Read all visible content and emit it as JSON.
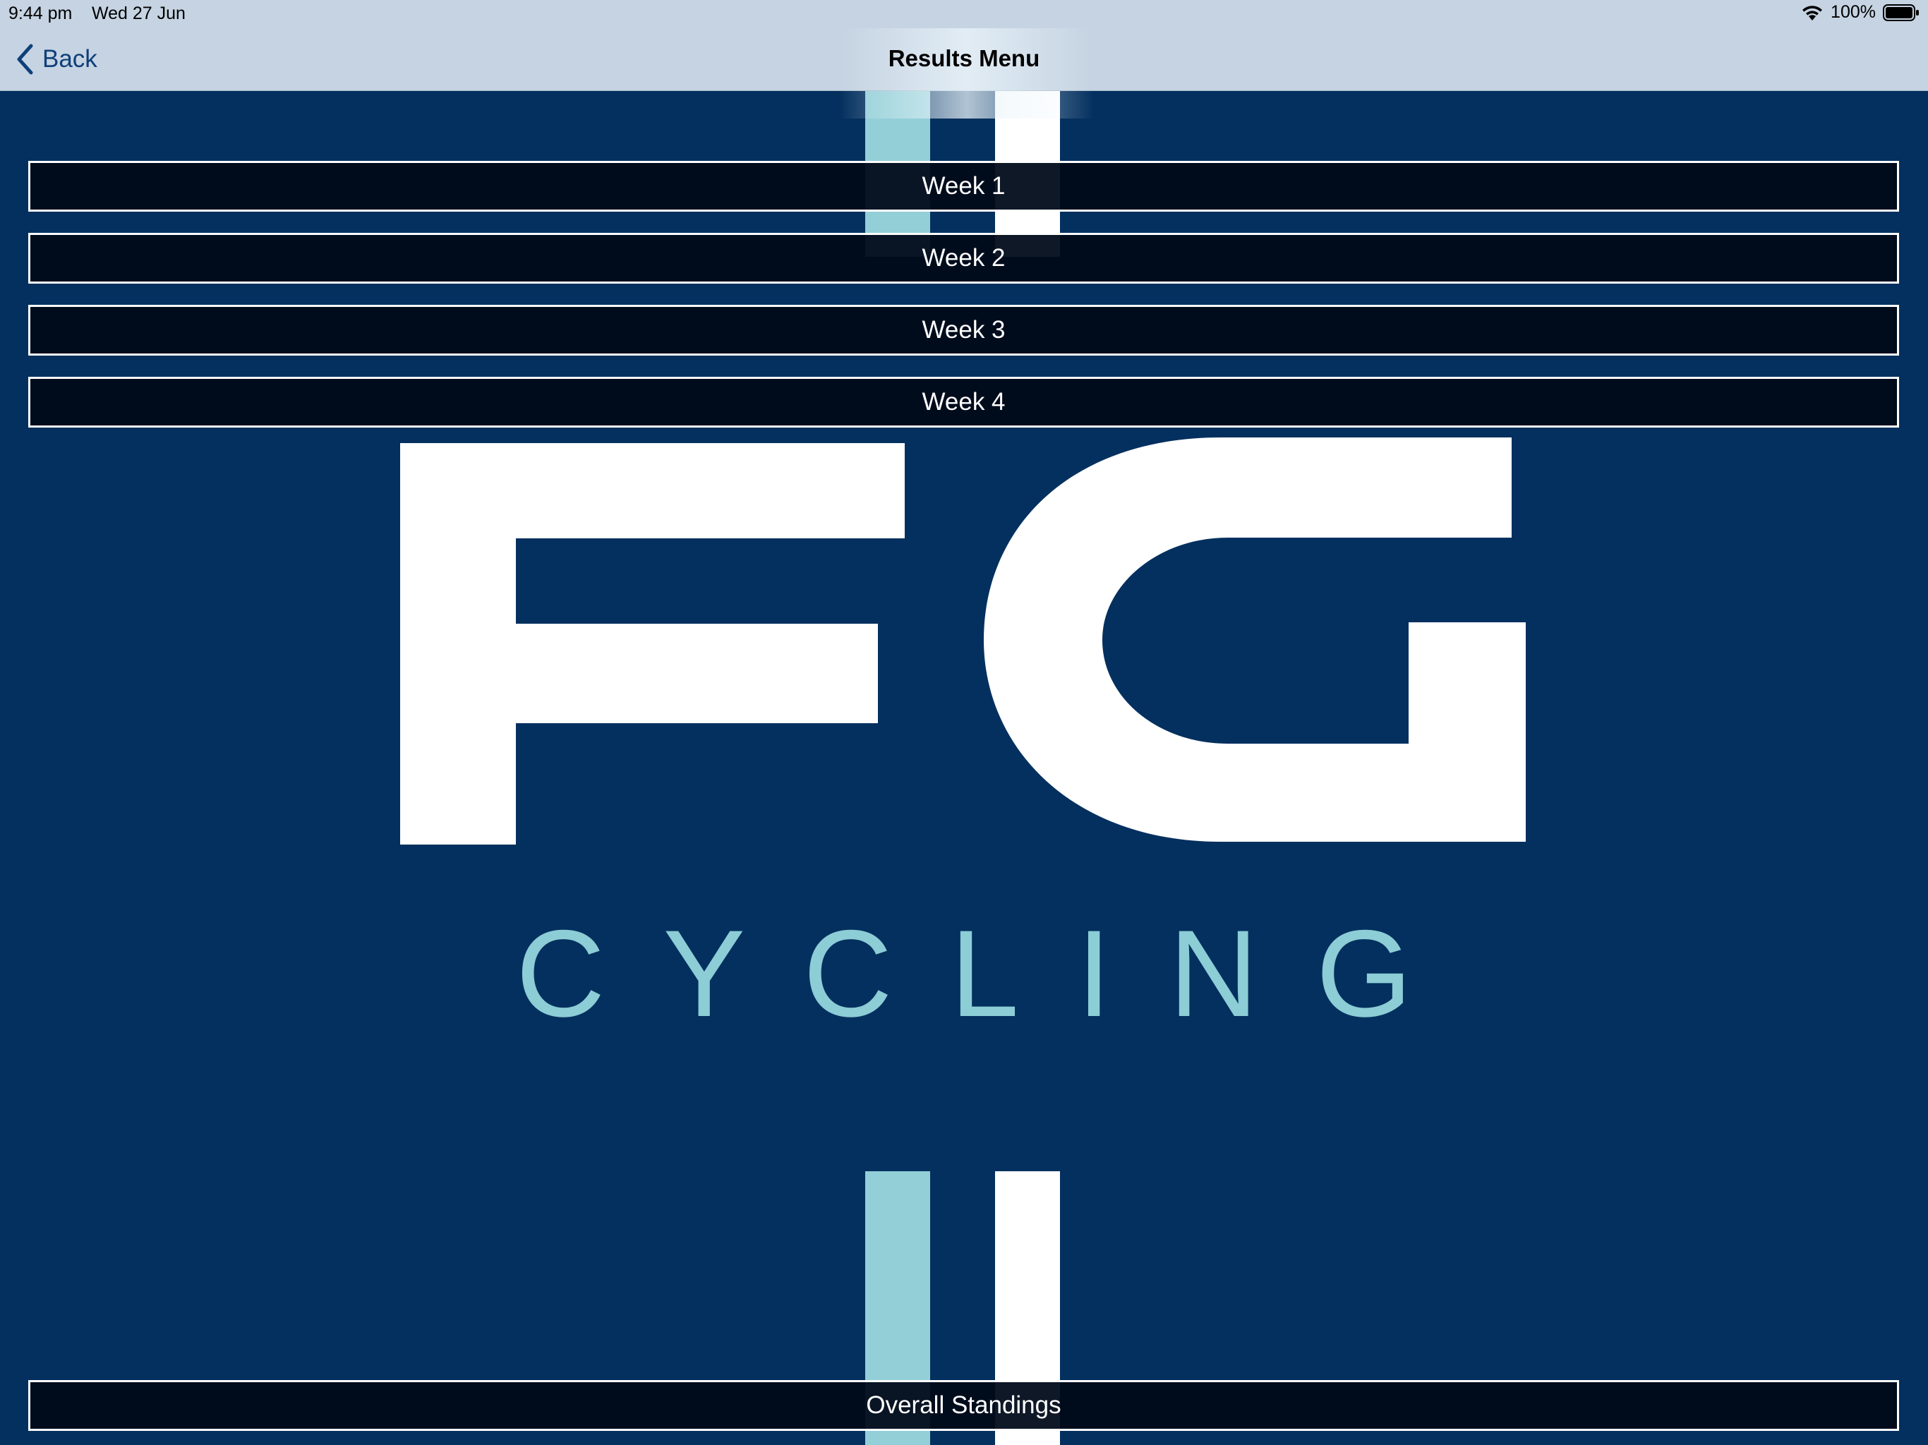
{
  "status_bar": {
    "time": "9:44 pm",
    "date": "Wed 27 Jun",
    "battery": "100%",
    "icons": [
      "wifi-icon",
      "battery-icon"
    ]
  },
  "nav": {
    "back_label": "Back",
    "back_icon": "chevron-left-icon",
    "title": "Results Menu"
  },
  "menu": {
    "items": [
      {
        "label": "Week 1"
      },
      {
        "label": "Week 2"
      },
      {
        "label": "Week 3"
      },
      {
        "label": "Week 4"
      }
    ],
    "overall_label": "Overall Standings"
  },
  "logo": {
    "letters": "FG",
    "subtitle": "CYCLING"
  },
  "colors": {
    "background": "#04305f",
    "accent_light_blue": "#93cfd7",
    "button_fill": "#000a18",
    "nav_bar": "#c5d3e2",
    "back_link": "#0f3f7a"
  }
}
